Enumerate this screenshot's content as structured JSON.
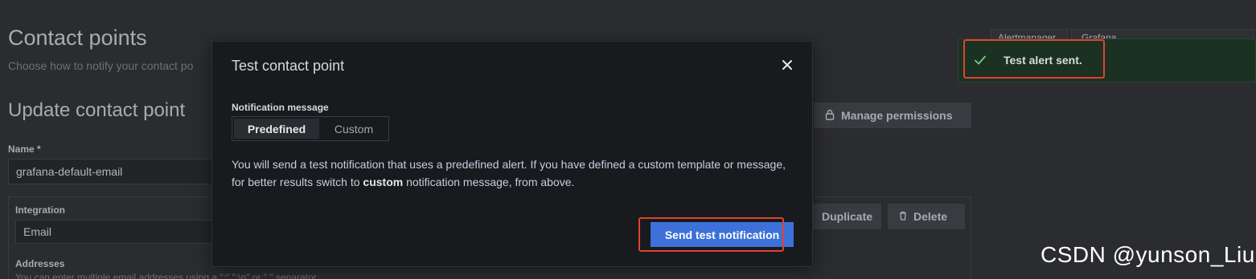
{
  "page": {
    "title": "Contact points",
    "subtitle": "Choose how to notify your contact po",
    "section_title": "Update contact point"
  },
  "form": {
    "name_label": "Name *",
    "name_value": "grafana-default-email",
    "integration_label": "Integration",
    "integration_value": "Email",
    "addresses_label": "Addresses",
    "addresses_hint": "You can enter multiple email addresses using a \";\" \";\\n\" or \",\" separator"
  },
  "actions": {
    "manage_permissions": "Manage permissions",
    "duplicate": "Duplicate",
    "delete": "Delete"
  },
  "alertmanager": {
    "label": "Alertmanager",
    "value": "Grafana"
  },
  "modal": {
    "title": "Test contact point",
    "message_label": "Notification message",
    "options": [
      "Predefined",
      "Custom"
    ],
    "selected_option": "Predefined",
    "description_part1": "You will send a test notification that uses a predefined alert. If you have defined a custom template or message, for better results switch to ",
    "description_bold": "custom",
    "description_part2": " notification message, from above.",
    "send_button": "Send test notification"
  },
  "toast": {
    "text": "Test alert sent.",
    "status": "success"
  },
  "watermark": "CSDN @yunson_Liu",
  "colors": {
    "background": "#2b2c2f",
    "modal_background": "#181a1e",
    "primary_button": "#3d71d9",
    "toast_background": "#1b3122",
    "success_icon": "#6ccf8e",
    "highlight_border": "#e0432d"
  }
}
